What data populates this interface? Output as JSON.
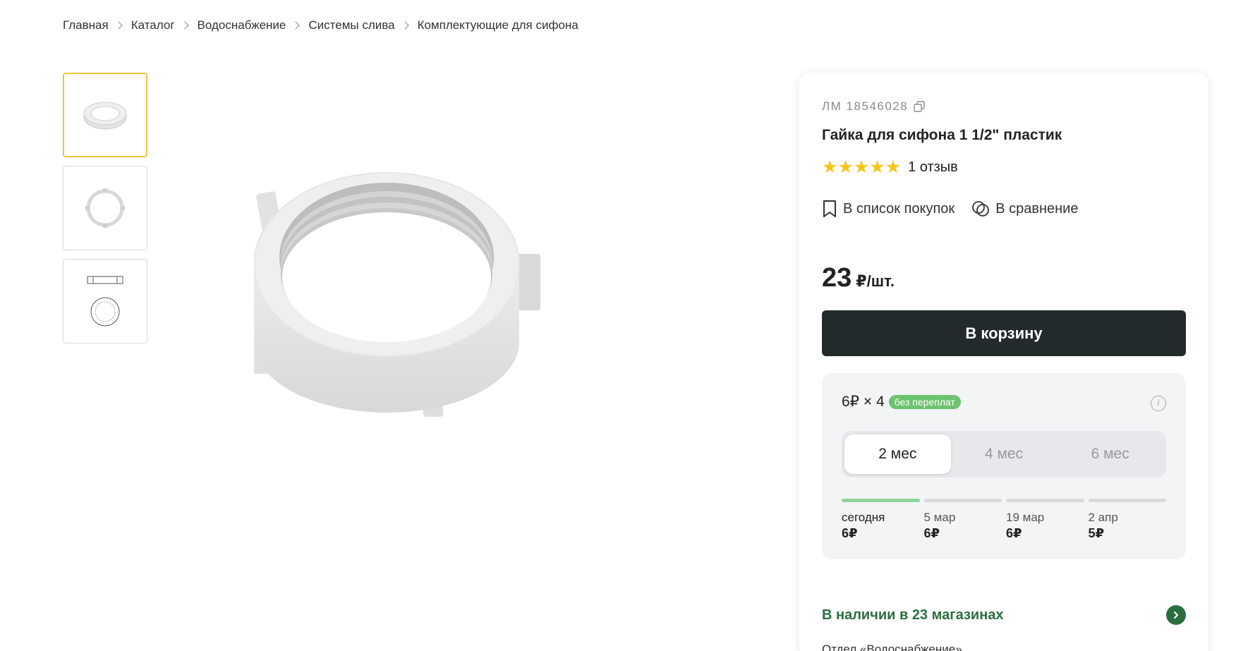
{
  "breadcrumbs": [
    "Главная",
    "Каталог",
    "Водоснабжение",
    "Системы слива",
    "Комплектующие для сифона"
  ],
  "product": {
    "sku_label": "ЛМ 18546028",
    "title": "Гайка для сифона 1 1/2\" пластик",
    "stars": 5,
    "reviews": "1 отзыв"
  },
  "actions": {
    "shopping_list": "В список покупок",
    "compare": "В сравнение"
  },
  "price": {
    "value": "23",
    "unit": "₽/шт."
  },
  "cart_button": "В корзину",
  "installment": {
    "formula": "6₽ × 4",
    "badge": "без переплат",
    "tabs": [
      {
        "label": "2 мес",
        "active": true
      },
      {
        "label": "4 мес",
        "active": false
      },
      {
        "label": "6 мес",
        "active": false
      }
    ],
    "schedule": [
      {
        "date": "сегодня",
        "amount": "6₽"
      },
      {
        "date": "5 мар",
        "amount": "6₽"
      },
      {
        "date": "19 мар",
        "amount": "6₽"
      },
      {
        "date": "2 апр",
        "amount": "5₽"
      }
    ]
  },
  "stock": {
    "text": "В наличии в 23 магазинах",
    "department": "Отдел «Водоснабжение»"
  },
  "colors": {
    "accent_green": "#2a6e3f",
    "badge_green": "#6cc36f",
    "button_dark": "#222a2b",
    "star": "#f5c518",
    "thumb_active": "#f2c23c"
  }
}
